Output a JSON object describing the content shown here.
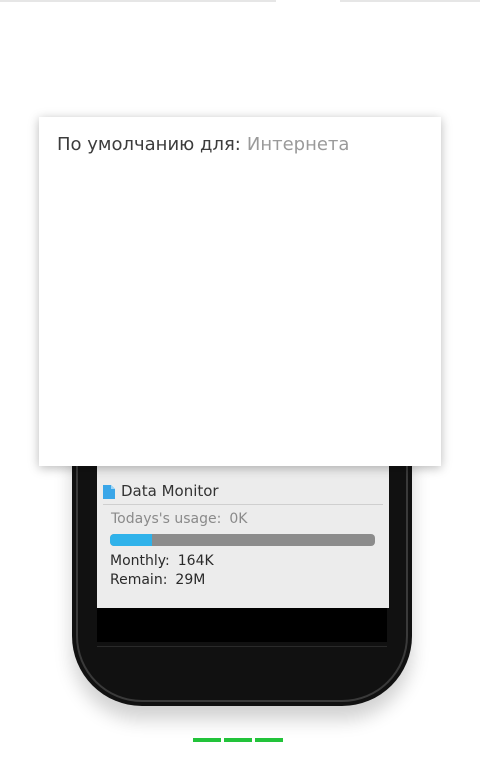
{
  "dialog": {
    "label": "По умолчанию для:",
    "app": "Интернета"
  },
  "widget": {
    "icon": "file-icon",
    "title": "Data Monitor",
    "usage_label": "Todays's usage:",
    "usage_value": "0K",
    "progress": 0.16,
    "accent": "#2fb2ea",
    "monthly_label": "Monthly:",
    "monthly_value": "164K",
    "remain_label": "Remain:",
    "remain_value": "29M"
  },
  "indicator": {
    "count": 3,
    "color": "#22c33a"
  }
}
